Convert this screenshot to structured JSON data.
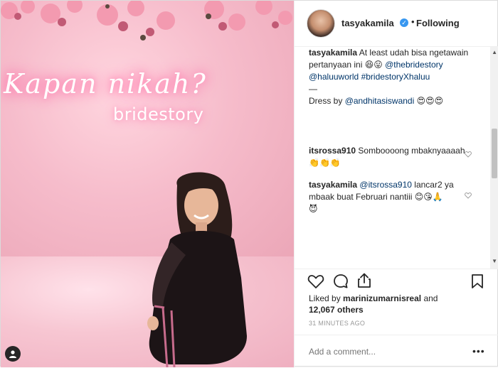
{
  "post": {
    "username": "tasyakamila",
    "follow_label": "Following",
    "dot": "•",
    "photo": {
      "neon_script": "Kapan nikah?",
      "neon_brand": "bridestory"
    },
    "caption": {
      "user": "tasyakamila",
      "text1": "At least udah bisa ngetawain pertanyaan ini",
      "emoji1": "😆😛",
      "mention1": "@thebridestory",
      "mention2": "@haluuworld",
      "hashtag": "#bridestoryXhaluu",
      "dash": "—",
      "dress_prefix": "Dress by",
      "dress_mention": "@andhitasiswandi",
      "dress_emoji": "😍😍😍"
    },
    "comments": [
      {
        "user": "itsrossa910",
        "text": "Somboooong mbaknyaaaah",
        "emoji": "👏👏👏"
      },
      {
        "user": "tasyakamila",
        "mention": "@itsrossa910",
        "text": "lancar2 ya mbaak buat Februari nantiii",
        "emoji": "😊😘🙏",
        "emoji2": "😈"
      }
    ],
    "likes": {
      "prefix": "Liked by",
      "user": "marinizumarnisreal",
      "and": "and",
      "count": "12,067 others"
    },
    "timestamp": "31 MINUTES AGO",
    "comment_placeholder": "Add a comment...",
    "more": "•••"
  }
}
